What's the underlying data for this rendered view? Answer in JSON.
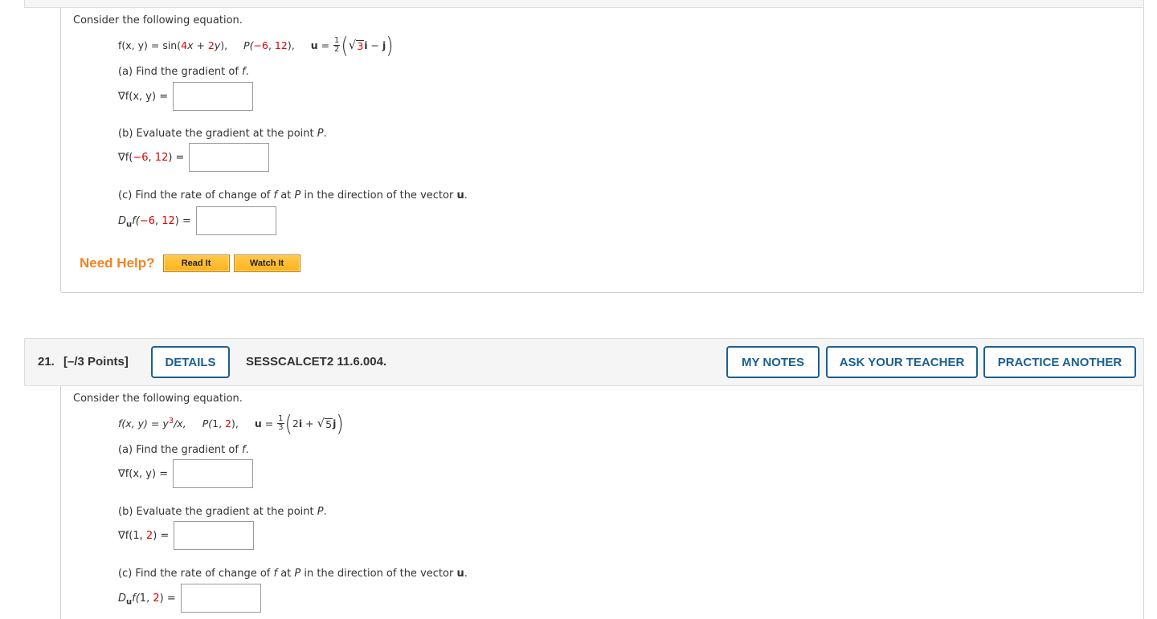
{
  "question20": {
    "intro": "Consider the following equation.",
    "function": {
      "lhs": "f(x, y) = sin(",
      "coef1": "4",
      "var1": "x",
      "plus": " + ",
      "coef2": "2",
      "var2": "y",
      "close": "),"
    },
    "point": {
      "label": "P(",
      "x": "−6",
      "sep": ", ",
      "y": "12",
      "close": "),"
    },
    "vector": {
      "name": "u",
      "eq": " = ",
      "frac_num": "1",
      "frac_den": "2",
      "radicand": "3",
      "i": "i",
      "op": " − ",
      "j": "j"
    },
    "parts": {
      "a": {
        "prompt_prefix": "(a) Find the gradient of ",
        "prompt_var": "f",
        "prompt_suffix": ".",
        "answer_label": "∇f(x, y) =",
        "value": ""
      },
      "b": {
        "prompt_prefix": "(b) Evaluate the gradient at the point ",
        "prompt_var": "P",
        "prompt_suffix": ".",
        "answer_prefix": "∇f(",
        "answer_x": "−6",
        "answer_sep": ", ",
        "answer_y": "12",
        "answer_suffix": ") =",
        "value": ""
      },
      "c": {
        "prompt_1": "(c) Find the rate of change of ",
        "prompt_f": "f",
        "prompt_2": " at ",
        "prompt_p": "P",
        "prompt_3": " in the direction of the vector ",
        "prompt_u": "u",
        "prompt_4": ".",
        "answer_D": "D",
        "answer_sub": "u",
        "answer_prefix": "f(",
        "answer_x": "−6",
        "answer_sep": ", ",
        "answer_y": "12",
        "answer_suffix": ") =",
        "value": ""
      }
    },
    "help": {
      "label": "Need Help?",
      "read_it": "Read It",
      "watch_it": "Watch It"
    }
  },
  "question21": {
    "header": {
      "number": "21.",
      "points": "[–/3 Points]",
      "details_button": "DETAILS",
      "code": "SESSCALCET2 11.6.004.",
      "my_notes_button": "MY NOTES",
      "ask_teacher_button": "ASK YOUR TEACHER",
      "practice_button": "PRACTICE ANOTHER"
    },
    "intro": "Consider the following equation.",
    "function": {
      "lhs": "f(x, y) = y",
      "exp": "3",
      "rhs": "/x,"
    },
    "point": {
      "label": "P(",
      "x": "1",
      "sep": ", ",
      "y": "2",
      "close": "),"
    },
    "vector": {
      "name": "u",
      "eq": " = ",
      "frac_num": "1",
      "frac_den": "3",
      "coef_i": "2",
      "i": "i",
      "op": " + ",
      "radicand": "5",
      "j": "j"
    },
    "parts": {
      "a": {
        "prompt_prefix": "(a) Find the gradient of ",
        "prompt_var": "f",
        "prompt_suffix": ".",
        "answer_label": "∇f(x, y) =",
        "value": ""
      },
      "b": {
        "prompt_prefix": "(b) Evaluate the gradient at the point ",
        "prompt_var": "P",
        "prompt_suffix": ".",
        "answer_prefix": "∇f(",
        "answer_x": "1",
        "answer_sep": ", ",
        "answer_y": "2",
        "answer_suffix": ") =",
        "value": ""
      },
      "c": {
        "prompt_1": "(c) Find the rate of change of ",
        "prompt_f": "f",
        "prompt_2": " at ",
        "prompt_p": "P",
        "prompt_3": " in the direction of the vector ",
        "prompt_u": "u",
        "prompt_4": ".",
        "answer_D": "D",
        "answer_sub": "u",
        "answer_prefix": "f(",
        "answer_x": "1",
        "answer_sep": ", ",
        "answer_y": "2",
        "answer_suffix": ") =",
        "value": ""
      }
    }
  },
  "colors": {
    "highlight_red": "#e00000",
    "accent_blue": "#1a5f91",
    "help_orange": "#f58220",
    "help_button": "#ffb21a"
  }
}
